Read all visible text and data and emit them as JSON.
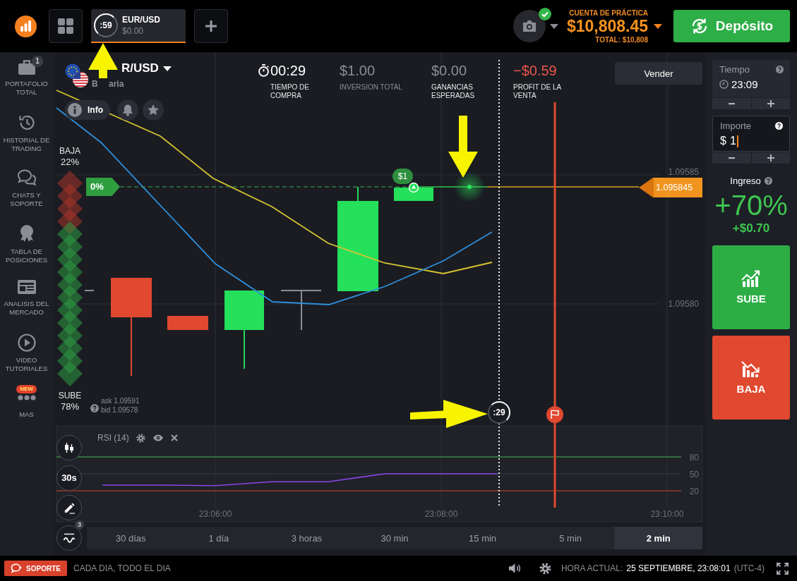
{
  "top_bar": {
    "tabs": [
      {
        "timer": ":59",
        "symbol": "EUR/USD",
        "amount": "$0.00",
        "selected": true
      }
    ],
    "camera": {
      "verified": true
    },
    "account": {
      "label": "CUENTA DE PRÁCTICA",
      "balance": "$10,808.45",
      "total": "TOTAL: $10,808"
    },
    "deposit_button": "Depósito"
  },
  "sidebar": {
    "items": [
      {
        "kind": "portfolio",
        "label": "PORTAFOLIO TOTAL",
        "badge": "1"
      },
      {
        "kind": "history",
        "label": "HISTORIAL DE TRADING"
      },
      {
        "kind": "chat",
        "label": "CHATS Y SOPORTE"
      },
      {
        "kind": "ranking",
        "label": "TABLA DE POSICIONES"
      },
      {
        "kind": "news",
        "label": "ANALISIS DEL MERCADO"
      },
      {
        "kind": "video",
        "label": "VIDEO TUTORIALES"
      },
      {
        "kind": "more",
        "label": "MAS",
        "badge": "NEW"
      }
    ]
  },
  "chart": {
    "asset": {
      "name": "R/USD",
      "type_before": "B",
      "type_after": "aria"
    },
    "info_button": "Info",
    "stats": [
      {
        "kind": "timer",
        "value": "00:29",
        "label": "TIEMPO DE COMPRA"
      },
      {
        "kind": "muted",
        "value": "$1.00",
        "label": "INVERSION TOTAL"
      },
      {
        "kind": "neutral",
        "value": "$0.00",
        "label": "GANANCIAS ESPERADAS"
      },
      {
        "kind": "loss",
        "value": "−$0.59",
        "label": "PROFIT DE LA VENTA"
      }
    ],
    "sell_button": "Vender",
    "sentiment": {
      "down_label": "BAJA",
      "down_share": "22%",
      "up_label": "SUBE",
      "up_share": "78%",
      "level": 0.78
    },
    "entry_tag": "0%",
    "investment_bubble": "$1",
    "current_price": "1.095845",
    "price_axis": [
      "1.09585",
      "1.09580"
    ],
    "quote": {
      "ask": "ask 1.09591",
      "bid": "bid 1.09578"
    },
    "purchase_timer": ":29",
    "rsi": {
      "chart_data": {
        "type": "line",
        "title": "RSI (14)",
        "categories": [
          null,
          null,
          "23:06:00",
          null,
          null,
          null,
          "23:08:00",
          null,
          null,
          null,
          "23:10:00"
        ],
        "series": [
          {
            "color": "#8a46e6",
            "values": [
              30,
              30,
              29,
              36,
              36,
              50,
              50,
              50,
              null,
              null,
              null
            ]
          }
        ],
        "ylim": [
          -35,
          135
        ],
        "yticks": [
          20,
          50,
          80
        ],
        "grid": true,
        "ref_lines": [
          {
            "axis": "y",
            "value": 80,
            "color": "#4cb34f"
          },
          {
            "axis": "y",
            "value": 50,
            "color": "#3a3d45"
          },
          {
            "axis": "y",
            "value": 20,
            "color": "#d2452d"
          }
        ]
      }
    },
    "tools": [
      {
        "kind": "chart_type"
      },
      {
        "kind": "interval",
        "label": "30s"
      },
      {
        "kind": "drawing"
      },
      {
        "kind": "indicators",
        "badge": "3"
      }
    ],
    "ranges": [
      {
        "label": "30 días",
        "selected": false
      },
      {
        "label": "1 día",
        "selected": false
      },
      {
        "label": "3 horas",
        "selected": false
      },
      {
        "label": "30 min",
        "selected": false
      },
      {
        "label": "15 min",
        "selected": false
      },
      {
        "label": "5 min",
        "selected": false
      },
      {
        "label": "2 min",
        "selected": true
      }
    ]
  },
  "trade_panel": {
    "time": {
      "label": "Tiempo",
      "value": "23:09"
    },
    "amount": {
      "label": "Importe",
      "currency": "$",
      "value": "1",
      "focused": true
    },
    "payout": {
      "label": "Ingreso",
      "percent": "+70%",
      "profit": "+$0.70"
    },
    "buttons": [
      {
        "kind": "up",
        "label": "SUBE"
      },
      {
        "kind": "down",
        "label": "BAJA"
      }
    ]
  },
  "footer": {
    "support_button": "SOPORTE",
    "hours": "CADA DIA, TODO EL DIA",
    "clock_label": "HORA ACTUAL:",
    "clock_value": "25 SEPTIEMBRE, 23:08:01",
    "timezone": "(UTC-4)"
  }
}
